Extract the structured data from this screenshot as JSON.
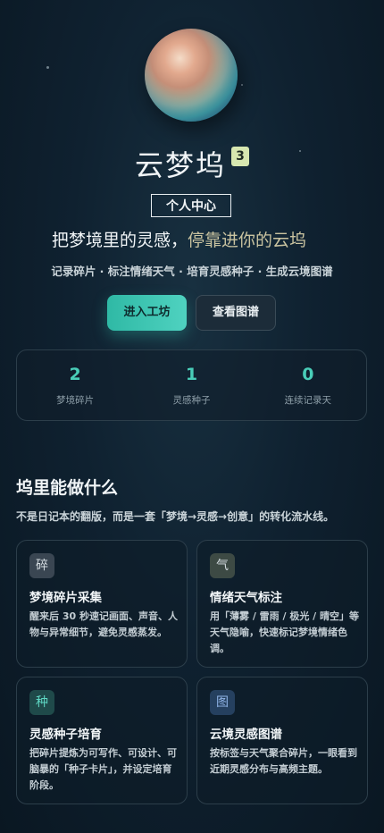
{
  "hero": {
    "app_title": "云梦坞",
    "badge": "3",
    "profile_button": "个人中心",
    "tagline_part1": "把梦境里的灵感，",
    "tagline_part2": "停靠进你的云坞",
    "features_line": "记录碎片 · 标注情绪天气 · 培育灵感种子 · 生成云境图谱",
    "primary_button": "进入工坊",
    "secondary_button": "查看图谱"
  },
  "stats": [
    {
      "value": "2",
      "label": "梦境碎片"
    },
    {
      "value": "1",
      "label": "灵感种子"
    },
    {
      "value": "0",
      "label": "连续记录天"
    }
  ],
  "section": {
    "title": "坞里能做什么",
    "description": "不是日记本的翻版，而是一套「梦境→灵感→创意」的转化流水线。"
  },
  "cards": [
    {
      "icon": "碎",
      "icon_name": "fragment-icon",
      "title": "梦境碎片采集",
      "desc": "醒来后 30 秒速记画面、声音、人物与异常细节，避免灵感蒸发。"
    },
    {
      "icon": "气",
      "icon_name": "weather-icon",
      "title": "情绪天气标注",
      "desc": "用「薄雾 / 雷雨 / 极光 / 晴空」等天气隐喻，快速标记梦境情绪色调。"
    },
    {
      "icon": "种",
      "icon_name": "seed-icon",
      "title": "灵感种子培育",
      "desc": "把碎片提炼为可写作、可设计、可脑暴的「种子卡片」，并设定培育阶段。"
    },
    {
      "icon": "图",
      "icon_name": "map-icon",
      "title": "云境灵感图谱",
      "desc": "按标签与天气聚合碎片，一眼看到近期灵感分布与高频主题。"
    }
  ],
  "colors": {
    "accent": "#49cdb8",
    "card_icon_bg": [
      "#3a4652",
      "#3d4a44",
      "#1f4a4a",
      "#25405f"
    ],
    "card_icon_fg": [
      "#d6dde2",
      "#d6dde2",
      "#5fd8c4",
      "#8fb3e6"
    ]
  }
}
